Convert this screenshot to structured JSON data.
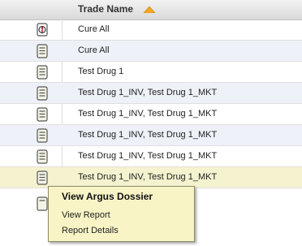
{
  "header": {
    "trade_name_label": "Trade Name"
  },
  "rows": [
    {
      "name": "Cure All",
      "icon": "sticky-pin-icon"
    },
    {
      "name": "Cure All",
      "icon": "document-icon"
    },
    {
      "name": "Test Drug 1",
      "icon": "document-icon"
    },
    {
      "name": "Test Drug 1_INV, Test Drug 1_MKT",
      "icon": "document-icon"
    },
    {
      "name": "Test Drug 1_INV, Test Drug 1_MKT",
      "icon": "document-icon"
    },
    {
      "name": "Test Drug 1_INV, Test Drug 1_MKT",
      "icon": "document-icon"
    },
    {
      "name": "Test Drug 1_INV, Test Drug 1_MKT",
      "icon": "document-icon"
    },
    {
      "name": "Test Drug 1_INV, Test Drug 1_MKT",
      "icon": "document-icon"
    }
  ],
  "context_menu": {
    "items": [
      "View Argus Dossier",
      "View Report",
      "Report Details"
    ]
  },
  "colors": {
    "sort_arrow": "#f5a623",
    "row_alt": "#eef1f8",
    "row_selected": "#f5f2cf",
    "menu_bg": "#f8f4c6"
  }
}
